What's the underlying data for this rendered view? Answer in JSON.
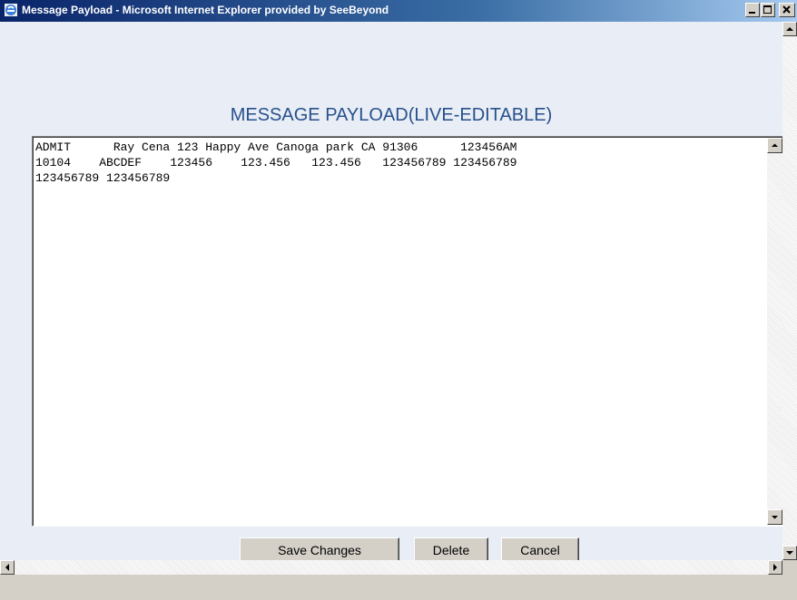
{
  "window": {
    "title": "Message Payload - Microsoft Internet Explorer provided by SeeBeyond"
  },
  "page": {
    "heading": "MESSAGE PAYLOAD(LIVE-EDITABLE)",
    "payload": "ADMIT      Ray Cena 123 Happy Ave Canoga park CA 91306      123456AM\n10104    ABCDEF    123456    123.456   123.456   123456789 123456789\n123456789 123456789"
  },
  "buttons": {
    "save_label": "Save Changes",
    "delete_label": "Delete",
    "cancel_label": "Cancel"
  },
  "icons": {
    "app": "ie-icon",
    "minimize": "minimize-icon",
    "maximize": "maximize-icon",
    "close": "close-icon",
    "scroll_up": "arrow-up-icon",
    "scroll_down": "arrow-down-icon",
    "scroll_left": "arrow-left-icon",
    "scroll_right": "arrow-right-icon"
  },
  "colors": {
    "titlebar_start": "#0a246a",
    "heading": "#28508c",
    "client_bg": "#e8edf6"
  }
}
